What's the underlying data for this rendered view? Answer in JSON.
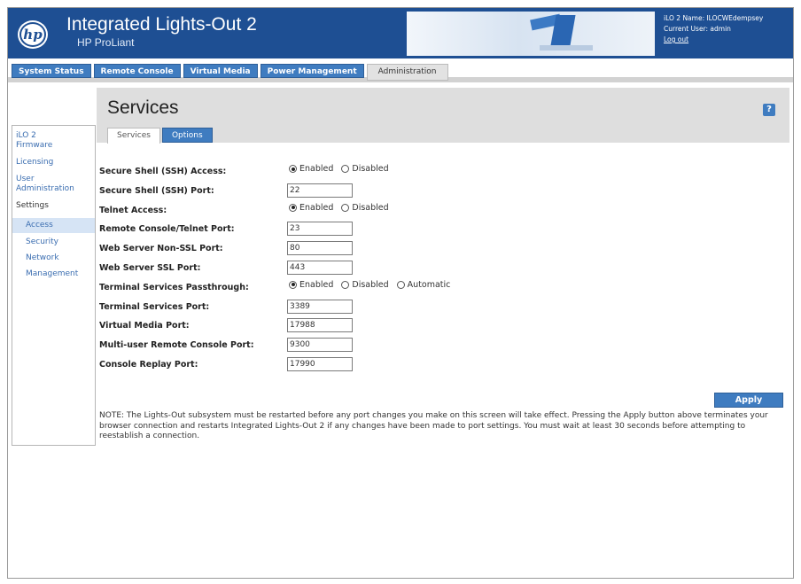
{
  "header": {
    "logo_text": "hp",
    "title": "Integrated Lights-Out 2",
    "subtitle": "HP ProLiant",
    "ilo_name_label": "iLO 2 Name: ILOCWEdempsey",
    "current_user_label": "Current User: admin",
    "logout_label": "Log out"
  },
  "topnav": {
    "tabs": [
      {
        "label": "System Status"
      },
      {
        "label": "Remote Console"
      },
      {
        "label": "Virtual Media"
      },
      {
        "label": "Power Management"
      },
      {
        "label": "Administration"
      }
    ]
  },
  "page": {
    "title": "Services",
    "help_icon": "?"
  },
  "subtabs": [
    {
      "label": "Services"
    },
    {
      "label": "Options"
    }
  ],
  "sidebar": {
    "items": [
      {
        "label": "iLO 2 Firmware"
      },
      {
        "label": "Licensing"
      },
      {
        "label": "User Administration"
      },
      {
        "label": "Settings"
      },
      {
        "label": "Access"
      },
      {
        "label": "Security"
      },
      {
        "label": "Network"
      },
      {
        "label": "Management"
      }
    ]
  },
  "form": {
    "ssh_access": {
      "label": "Secure Shell (SSH) Access:",
      "opt1": "Enabled",
      "opt2": "Disabled"
    },
    "ssh_port": {
      "label": "Secure Shell (SSH) Port:",
      "value": "22"
    },
    "telnet_access": {
      "label": "Telnet Access:",
      "opt1": "Enabled",
      "opt2": "Disabled"
    },
    "remote_console_port": {
      "label": "Remote Console/Telnet Port:",
      "value": "23"
    },
    "web_nonssl_port": {
      "label": "Web Server Non-SSL Port:",
      "value": "80"
    },
    "web_ssl_port": {
      "label": "Web Server SSL Port:",
      "value": "443"
    },
    "ts_passthrough": {
      "label": "Terminal Services Passthrough:",
      "opt1": "Enabled",
      "opt2": "Disabled",
      "opt3": "Automatic"
    },
    "ts_port": {
      "label": "Terminal Services Port:",
      "value": "3389"
    },
    "vm_port": {
      "label": "Virtual Media Port:",
      "value": "17988"
    },
    "multiuser_port": {
      "label": "Multi-user Remote Console Port:",
      "value": "9300"
    },
    "replay_port": {
      "label": "Console Replay Port:",
      "value": "17990"
    }
  },
  "apply_label": "Apply",
  "note": "NOTE: The Lights-Out subsystem must be restarted before any port changes you make on this screen will take effect. Pressing the Apply button above terminates your browser connection and restarts Integrated Lights-Out 2 if any changes have been made to port settings. You must wait at least 30 seconds before attempting to reestablish a connection."
}
